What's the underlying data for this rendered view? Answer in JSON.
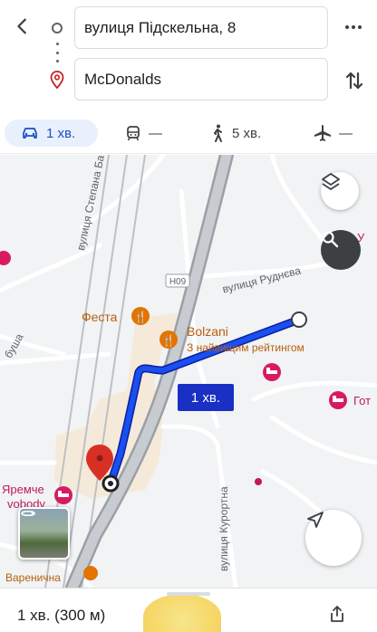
{
  "header": {
    "origin": "вулиця Підскельна, 8",
    "destination": "McDonalds"
  },
  "modes": [
    {
      "icon": "car-icon",
      "label": "1 хв.",
      "selected": true
    },
    {
      "icon": "train-icon",
      "label": "—"
    },
    {
      "icon": "walk-icon",
      "label": "5 хв."
    },
    {
      "icon": "airplane-icon",
      "label": "—"
    }
  ],
  "map": {
    "roads": {
      "stepana": "вулиця Степана Ба",
      "rudnieva": "вулиця Руднєва",
      "kurortna": "вулиця Курортна",
      "highway": "Н09",
      "busha": "буша",
      "u_kraina": "У"
    },
    "pois": {
      "festa": "Феста",
      "bolzani": "Bolzani",
      "bolzani_sub": "З найвищим рейтингом",
      "hotel_got": "Гот",
      "yaremche": "Яремче",
      "vobody": "vobody",
      "varenychna": "Варенична"
    },
    "route_badge": "1 хв.",
    "colors": {
      "route": "#1a2fc4",
      "hotel": "#d81b60",
      "poi": "#e37400"
    }
  },
  "bottom": {
    "summary": "1 хв. (300 м)"
  }
}
